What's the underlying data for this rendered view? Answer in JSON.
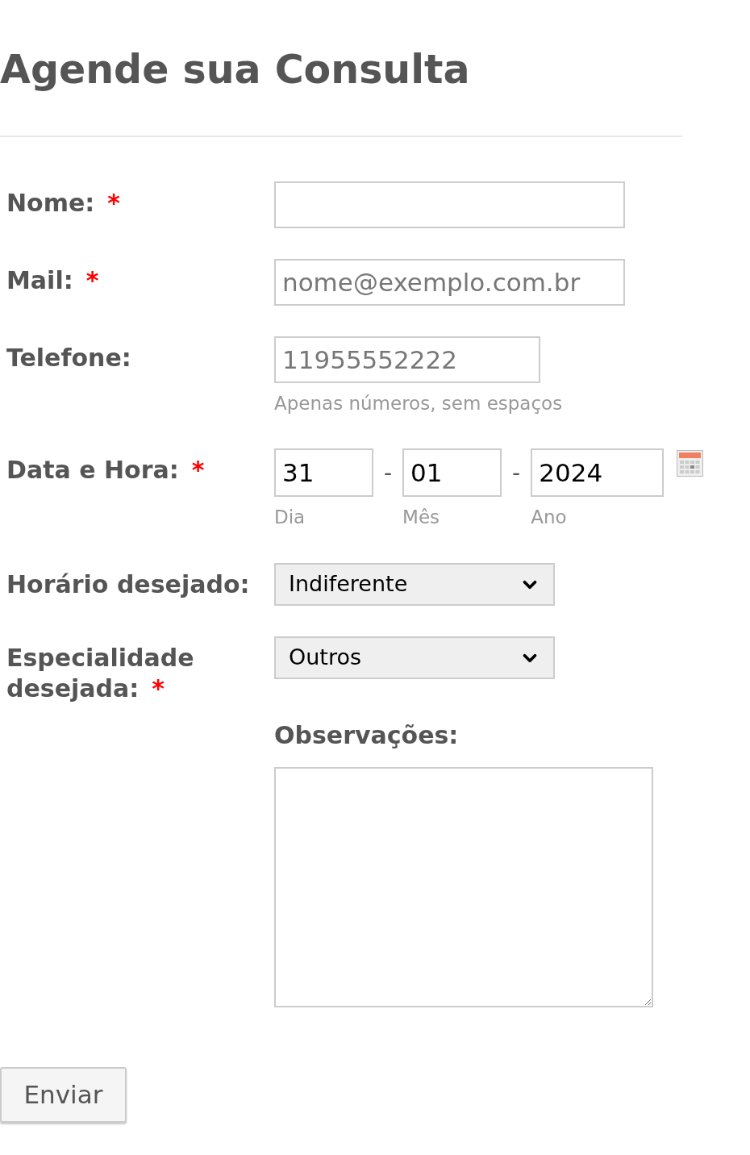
{
  "title": "Agende sua Consulta",
  "required_mark": "*",
  "fields": [
    {
      "kind": "text",
      "label": "Nome:",
      "required": true
    },
    {
      "kind": "text",
      "label": "Mail:",
      "required": true,
      "placeholder": "nome@exemplo.com.br"
    },
    {
      "kind": "tel",
      "label": "Telefone:",
      "required": false,
      "placeholder": "11955552222",
      "hint": "Apenas números, sem espaços"
    },
    {
      "kind": "date",
      "label": "Data e Hora:",
      "required": true,
      "separator": "-",
      "parts": [
        {
          "value": "31",
          "caption": "Dia"
        },
        {
          "value": "01",
          "caption": "Mês"
        },
        {
          "value": "2024",
          "caption": "Ano"
        }
      ]
    },
    {
      "kind": "select",
      "label": "Horário desejado:",
      "required": false,
      "value": "Indiferente"
    },
    {
      "kind": "select",
      "label": "Especialidade desejada:",
      "required": true,
      "value": "Outros"
    },
    {
      "kind": "textarea",
      "label": "Observações:",
      "required": false
    }
  ],
  "submit": "Enviar"
}
